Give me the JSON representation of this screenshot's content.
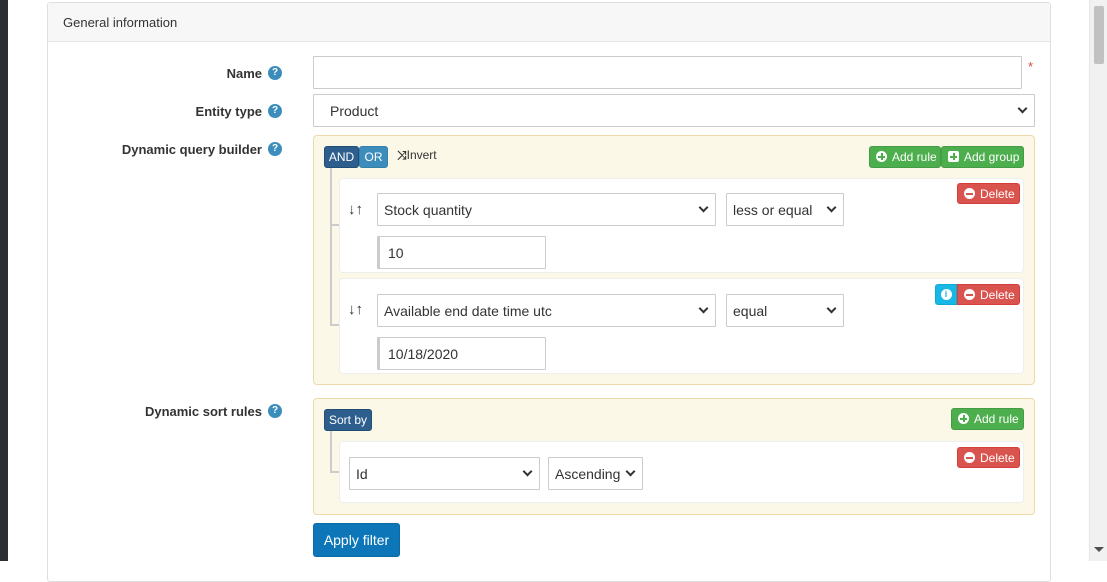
{
  "card": {
    "title": "General information"
  },
  "fields": {
    "name": {
      "label": "Name",
      "value": "",
      "required": "*"
    },
    "entity_type": {
      "label": "Entity type",
      "value": "Product"
    },
    "query_builder": {
      "label": "Dynamic query builder"
    },
    "sort_rules": {
      "label": "Dynamic sort rules"
    }
  },
  "help_glyph": "?",
  "query_builder": {
    "and_label": "AND",
    "or_label": "OR",
    "invert_label": "Invert",
    "add_rule_label": "Add rule",
    "add_group_label": "Add group",
    "rules": [
      {
        "field": "Stock quantity",
        "operator": "less or equal",
        "value": "10",
        "delete_label": "Delete"
      },
      {
        "field": "Available end date time utc",
        "operator": "equal",
        "value": "10/18/2020",
        "delete_label": "Delete",
        "info": "i"
      }
    ],
    "sort_glyph": "↓↑"
  },
  "sort_rules": {
    "sort_by_label": "Sort by",
    "add_rule_label": "Add rule",
    "rules": [
      {
        "field": "Id",
        "direction": "Ascending",
        "delete_label": "Delete"
      }
    ]
  },
  "apply_filter_label": "Apply filter",
  "colors": {
    "primary": "#0c76b9",
    "success": "#4cae4c",
    "danger": "#d9534f",
    "info": "#17b8e6",
    "help": "#3c8dbc",
    "panel_bg": "#fcf8e8"
  }
}
